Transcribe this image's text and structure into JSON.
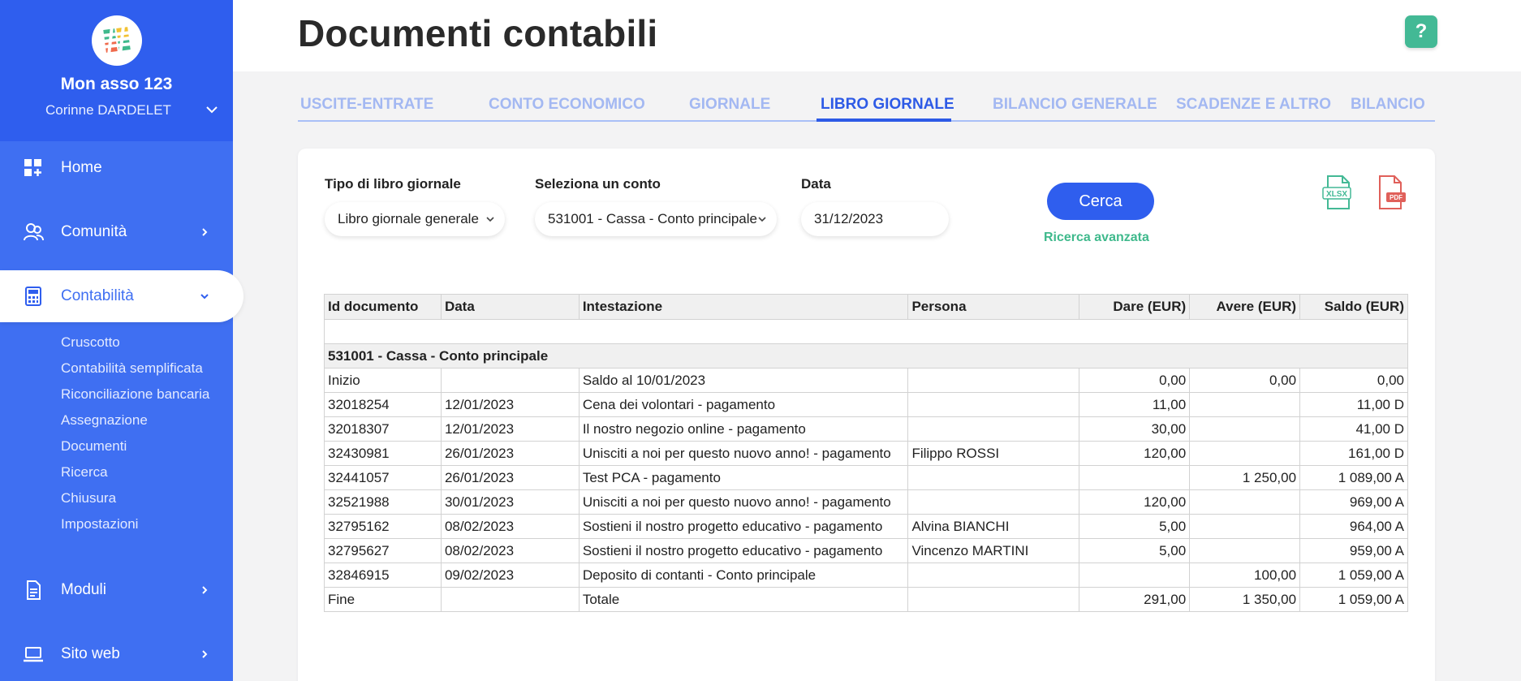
{
  "sidebar": {
    "org_name": "Mon asso 123",
    "user_name": "Corinne DARDELET",
    "nav": [
      {
        "label": "Home"
      },
      {
        "label": "Comunità"
      },
      {
        "label": "Contabilità"
      },
      {
        "label": "Moduli"
      },
      {
        "label": "Sito web"
      }
    ],
    "subnav": [
      "Cruscotto",
      "Contabilità semplificata",
      "Riconciliazione bancaria",
      "Assegnazione",
      "Documenti",
      "Ricerca",
      "Chiusura",
      "Impostazioni"
    ]
  },
  "header": {
    "title": "Documenti contabili",
    "help_label": "?"
  },
  "tabs": [
    "USCITE-ENTRATE",
    "CONTO ECONOMICO",
    "GIORNALE",
    "LIBRO GIORNALE",
    "BILANCIO GENERALE",
    "SCADENZE E ALTRO",
    "BILANCIO"
  ],
  "active_tab": "LIBRO GIORNALE",
  "filters": {
    "type_label": "Tipo di libro giornale",
    "type_value": "Libro giornale generale",
    "account_label": "Seleziona un conto",
    "account_value": "531001 - Cassa - Conto principale",
    "date_label": "Data",
    "date_value": "31/12/2023",
    "search_button": "Cerca",
    "advanced_link": "Ricerca avanzata",
    "export_xlsx": "XLSX",
    "export_pdf": "PDF"
  },
  "table": {
    "headers": [
      "Id documento",
      "Data",
      "Intestazione",
      "Persona",
      "Dare (EUR)",
      "Avere (EUR)",
      "Saldo (EUR)"
    ],
    "group": "531001 - Cassa - Conto principale",
    "rows": [
      [
        "Inizio",
        "",
        "Saldo al 10/01/2023",
        "",
        "0,00",
        "0,00",
        "0,00"
      ],
      [
        "32018254",
        "12/01/2023",
        "Cena dei volontari - pagamento",
        "",
        "11,00",
        "",
        "11,00 D"
      ],
      [
        "32018307",
        "12/01/2023",
        "Il nostro negozio online - pagamento",
        "",
        "30,00",
        "",
        "41,00 D"
      ],
      [
        "32430981",
        "26/01/2023",
        "Unisciti a noi per questo nuovo anno! - pagamento",
        "Filippo ROSSI",
        "120,00",
        "",
        "161,00 D"
      ],
      [
        "32441057",
        "26/01/2023",
        "Test PCA - pagamento",
        "",
        "",
        "1 250,00",
        "1 089,00 A"
      ],
      [
        "32521988",
        "30/01/2023",
        "Unisciti a noi per questo nuovo anno! - pagamento",
        "",
        "120,00",
        "",
        "969,00 A"
      ],
      [
        "32795162",
        "08/02/2023",
        "Sostieni il nostro progetto educativo - pagamento",
        "Alvina BIANCHI",
        "5,00",
        "",
        "964,00 A"
      ],
      [
        "32795627",
        "08/02/2023",
        "Sostieni il nostro progetto educativo - pagamento",
        "Vincenzo MARTINI",
        "5,00",
        "",
        "959,00 A"
      ],
      [
        "32846915",
        "09/02/2023",
        "Deposito di contanti - Conto principale",
        "",
        "",
        "100,00",
        "1 059,00 A"
      ],
      [
        "Fine",
        "",
        "Totale",
        "",
        "291,00",
        "1 350,00",
        "1 059,00 A"
      ]
    ]
  },
  "colors": {
    "sidebar": "#3f6ff2",
    "accent": "#2f5eee",
    "green": "#43b995",
    "pdf_red": "#e0605a"
  }
}
